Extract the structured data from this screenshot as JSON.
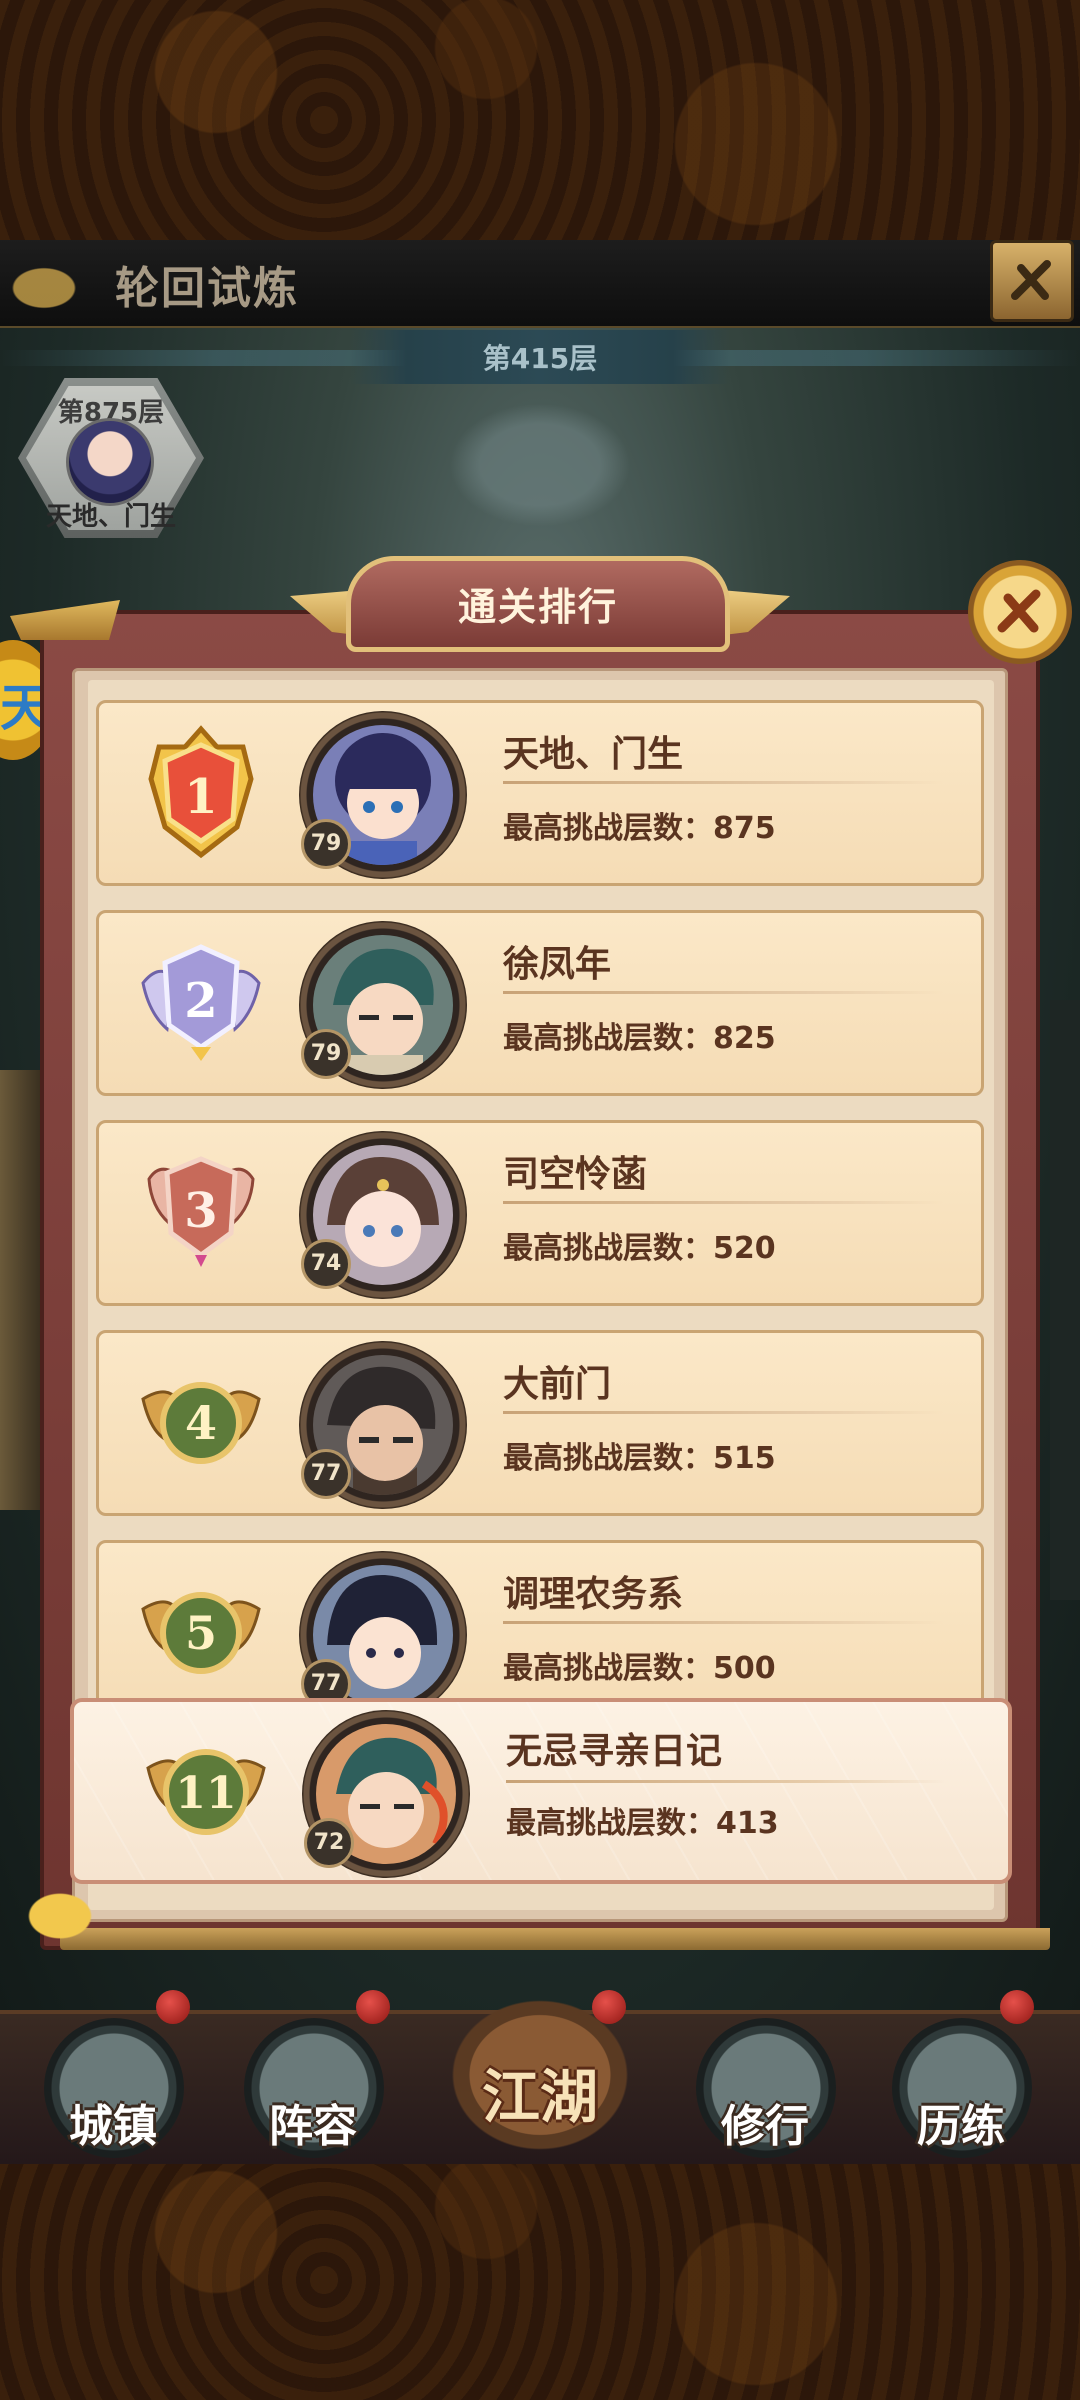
{
  "header": {
    "title": "轮回试炼"
  },
  "current_floor": "第415层",
  "record": {
    "floor": "第875层",
    "name": "天地、门生"
  },
  "side_button": "天",
  "modal": {
    "title": "通关排行"
  },
  "score_label": "最高挑战层数：",
  "rankings": [
    {
      "rank": "1",
      "name": "天地、门生",
      "level": "79",
      "score": "875",
      "medal": "gold"
    },
    {
      "rank": "2",
      "name": "徐凤年",
      "level": "79",
      "score": "825",
      "medal": "silver"
    },
    {
      "rank": "3",
      "name": "司空怜菡",
      "level": "74",
      "score": "520",
      "medal": "bronze"
    },
    {
      "rank": "4",
      "name": "大前门",
      "level": "77",
      "score": "515",
      "medal": "plain"
    },
    {
      "rank": "5",
      "name": "调理农务系",
      "level": "77",
      "score": "500",
      "medal": "plain"
    }
  ],
  "self": {
    "rank": "11",
    "name": "无忌寻亲日记",
    "level": "72",
    "score": "413"
  },
  "nav": {
    "town": "城镇",
    "lineup": "阵容",
    "jianghu": "江湖",
    "practice": "修行",
    "training": "历练"
  },
  "colors": {
    "panel_border": "#7b3b36",
    "row_bg": "#fbe8c8",
    "text_brown": "#5a3420",
    "gold": "#d9a437"
  }
}
